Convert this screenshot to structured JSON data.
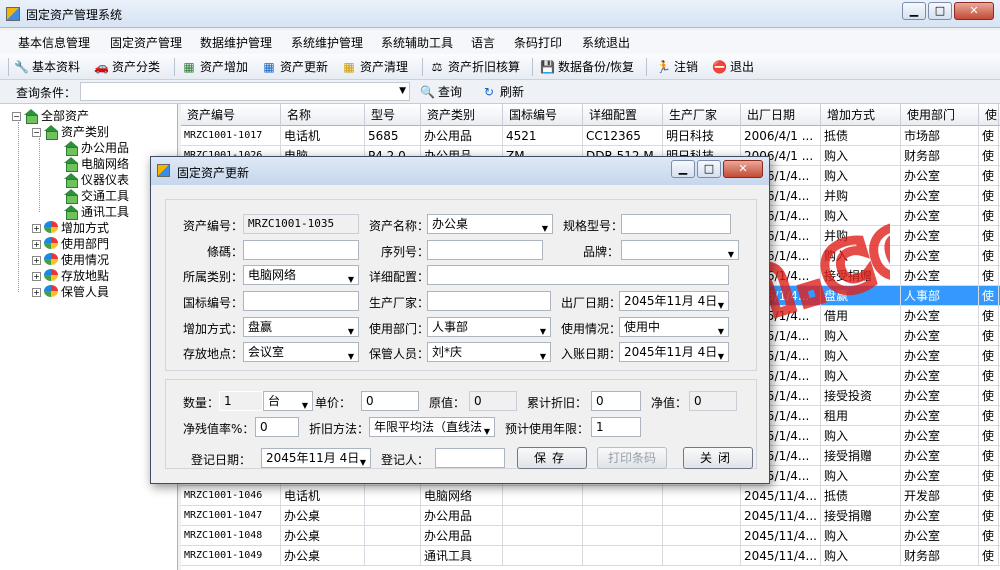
{
  "window": {
    "title": "固定资产管理系统",
    "btn_min": "▁",
    "btn_max": "□",
    "btn_close": "✕"
  },
  "menu": [
    "基本信息管理",
    "固定资产管理",
    "数据维护管理",
    "系统维护管理",
    "系统辅助工具",
    "语言",
    "条码打印",
    "系统退出"
  ],
  "toolbar": [
    {
      "label": "基本资料",
      "icon": "wrench-icon"
    },
    {
      "label": "资产分类",
      "icon": "car-icon"
    },
    {
      "label": "资产增加",
      "icon": "add-icon"
    },
    {
      "label": "资产更新",
      "icon": "update-icon"
    },
    {
      "label": "资产清理",
      "icon": "clean-icon"
    },
    {
      "label": "资产折旧核算",
      "icon": "calc-icon"
    },
    {
      "label": "数据备份/恢复",
      "icon": "backup-icon"
    },
    {
      "label": "注销",
      "icon": "logout-icon"
    },
    {
      "label": "退出",
      "icon": "exit-icon"
    }
  ],
  "query": {
    "label": "查询条件：",
    "search_label": "查询",
    "refresh_label": "刷新"
  },
  "tree": {
    "root": "全部资产",
    "category": "资产类别",
    "children": [
      "办公用品",
      "电脑网络",
      "仪器仪表",
      "交通工具",
      "通讯工具"
    ],
    "others": [
      "增加方式",
      "使用部門",
      "使用情况",
      "存放地點",
      "保管人員"
    ]
  },
  "grid": {
    "columns": [
      "资产编号",
      "名称",
      "型号",
      "资产类别",
      "国标编号",
      "详细配置",
      "生产厂家",
      "出厂日期",
      "增加方式",
      "使用部门",
      "使"
    ],
    "rows": [
      [
        "MRZC1001-1017",
        "电话机",
        "5685",
        "办公用品",
        "4521",
        "CC12365",
        "明日科技",
        "2006/4/1 ...",
        "抵债",
        "市场部",
        "使"
      ],
      [
        "MRZC1001-1026",
        "电脑",
        "P4 2.0",
        "办公用品",
        "ZM",
        "DDR 512 M",
        "明日科技",
        "2006/4/1 ...",
        "购入",
        "财务部",
        "使"
      ],
      [
        "MRZC1001-1027",
        "",
        "",
        "",
        "",
        "",
        "",
        "2006/1/4...",
        "购入",
        "办公室",
        "使"
      ],
      [
        "",
        "",
        "",
        "",
        "",
        "",
        "",
        "2006/1/4...",
        "并购",
        "办公室",
        "使"
      ],
      [
        "",
        "",
        "",
        "",
        "",
        "",
        "",
        "2006/1/4...",
        "购入",
        "办公室",
        "使"
      ],
      [
        "",
        "",
        "",
        "",
        "",
        "",
        "",
        "2006/1/4...",
        "并购",
        "办公室",
        "使"
      ],
      [
        "",
        "",
        "",
        "",
        "",
        "",
        "",
        "2006/1/4...",
        "购入",
        "办公室",
        "使"
      ],
      [
        "",
        "",
        "",
        "",
        "",
        "",
        "",
        "2006/1/4...",
        "接受捐赠",
        "办公室",
        "使"
      ],
      [
        "",
        "",
        "",
        "",
        "",
        "",
        "",
        "2045/1/4...",
        "盘赢",
        "人事部",
        "使"
      ],
      [
        "",
        "",
        "",
        "",
        "",
        "",
        "",
        "2045/1/4...",
        "借用",
        "办公室",
        "使"
      ],
      [
        "",
        "",
        "",
        "",
        "",
        "",
        "",
        "2045/1/4...",
        "购入",
        "办公室",
        "使"
      ],
      [
        "",
        "",
        "",
        "",
        "",
        "",
        "",
        "2045/1/4...",
        "购入",
        "办公室",
        "使"
      ],
      [
        "",
        "",
        "",
        "",
        "",
        "",
        "",
        "2045/1/4...",
        "购入",
        "办公室",
        "使"
      ],
      [
        "",
        "",
        "",
        "",
        "",
        "",
        "",
        "2045/1/4...",
        "接受投资",
        "办公室",
        "使"
      ],
      [
        "",
        "",
        "",
        "",
        "",
        "",
        "",
        "2045/1/4...",
        "租用",
        "办公室",
        "使"
      ],
      [
        "",
        "",
        "",
        "",
        "",
        "",
        "",
        "2045/1/4...",
        "购入",
        "办公室",
        "使"
      ],
      [
        "",
        "",
        "",
        "",
        "",
        "",
        "",
        "2045/1/4...",
        "接受捐赠",
        "办公室",
        "使"
      ],
      [
        "",
        "",
        "",
        "",
        "",
        "",
        "",
        "2045/1/4...",
        "购入",
        "办公室",
        "使"
      ],
      [
        "MRZC1001-1046",
        "电话机",
        "",
        "电脑网络",
        "",
        "",
        "",
        "2045/11/4...",
        "抵债",
        "开发部",
        "使"
      ],
      [
        "MRZC1001-1047",
        "办公桌",
        "",
        "办公用品",
        "",
        "",
        "",
        "2045/11/4...",
        "接受捐赠",
        "办公室",
        "使"
      ],
      [
        "MRZC1001-1048",
        "办公桌",
        "",
        "办公用品",
        "",
        "",
        "",
        "2045/11/4...",
        "购入",
        "办公室",
        "使"
      ],
      [
        "MRZC1001-1049",
        "办公桌",
        "",
        "通讯工具",
        "",
        "",
        "",
        "2045/11/4...",
        "购入",
        "财务部",
        "使"
      ]
    ],
    "selected_row": 8
  },
  "dialog": {
    "title": "固定资产更新",
    "asset_no_label": "资产编号：",
    "asset_no": "MRZC1001-1035",
    "asset_name_label": "资产名称：",
    "asset_name": "办公桌",
    "spec_label": "规格型号：",
    "spec": "",
    "code_label": "條碼：",
    "code": "",
    "serial_label": "序列号：",
    "serial": "",
    "brand_label": "品牌：",
    "brand": "",
    "category_label": "所属类别：",
    "category": "电脑网络",
    "config_label": "详细配置：",
    "config": "",
    "gb_label": "国标编号：",
    "gb": "",
    "maker_label": "生产厂家：",
    "maker": "",
    "mfg_date_label": "出厂日期：",
    "mfg_date": "2045年11月 4日",
    "add_method_label": "增加方式：",
    "add_method": "盘赢",
    "dept_label": "使用部门：",
    "dept": "人事部",
    "usage_label": "使用情况：",
    "usage": "使用中",
    "location_label": "存放地点：",
    "location": "会议室",
    "keeper_label": "保管人员：",
    "keeper": "刘*庆",
    "entry_date_label": "入账日期：",
    "entry_date": "2045年11月 4日",
    "qty_label": "数量：",
    "qty": "1",
    "unit": "台",
    "price_label": "单价：",
    "price": "0",
    "orig_label": "原值：",
    "orig": "0",
    "accum_label": "累计折旧：",
    "accum": "0",
    "net_label": "净值：",
    "net": "0",
    "residual_label": "净残值率%：",
    "residual": "0",
    "method_label": "折旧方法：",
    "method": "年限平均法（直线法",
    "life_label": "预计使用年限：",
    "life": "1",
    "reg_date_label": "登记日期：",
    "reg_date": "2045年11月 4日",
    "registrar_label": "登记人：",
    "registrar": "",
    "save_label": "保存",
    "print_label": "打印条码",
    "close_label": "关闭"
  },
  "watermark": "www.taoydm.com",
  "colors": {
    "selection": "#3399ff",
    "watermark": "#e0211b"
  }
}
